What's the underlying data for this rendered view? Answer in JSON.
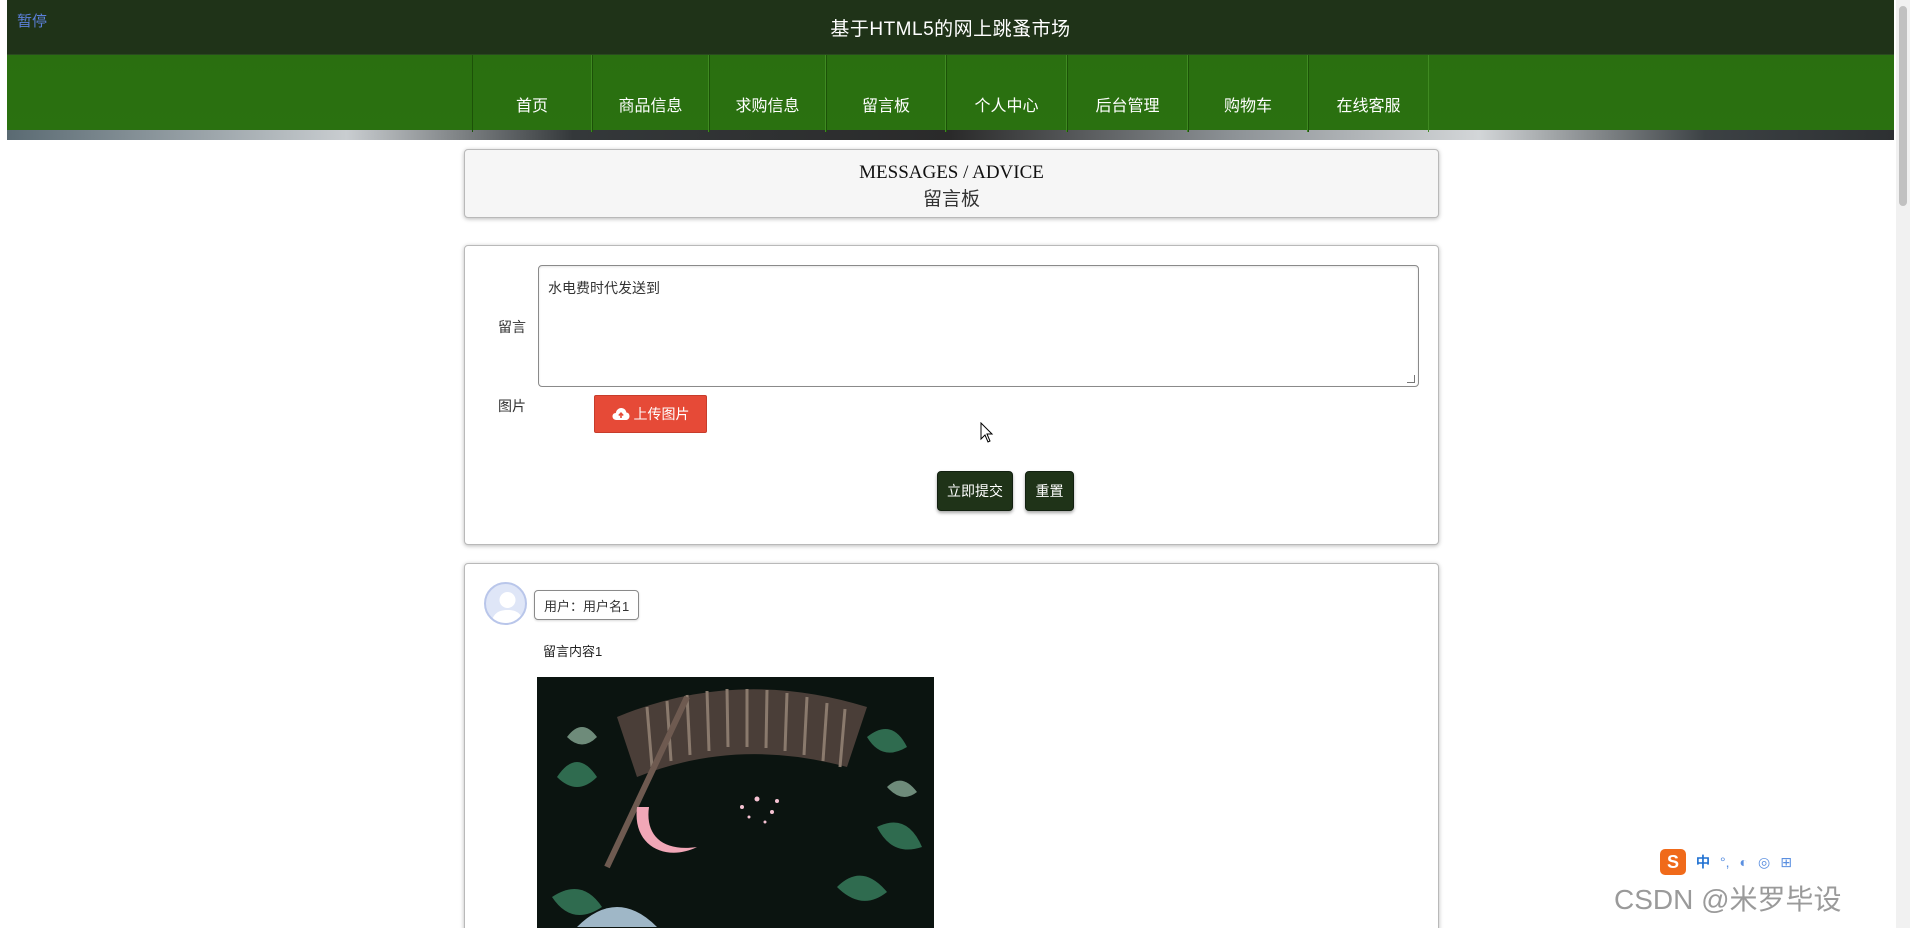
{
  "header": {
    "pause_label": "暂停",
    "site_title": "基于HTML5的网上跳蚤市场"
  },
  "nav": {
    "items": [
      "首页",
      "商品信息",
      "求购信息",
      "留言板",
      "个人中心",
      "后台管理",
      "购物车",
      "在线客服"
    ]
  },
  "section_header": {
    "title_en": "MESSAGES / ADVICE",
    "title_cn": "留言板"
  },
  "form": {
    "message_label": "留言",
    "message_value": "水电费时代发送到",
    "image_label": "图片",
    "upload_label": "上传图片",
    "submit_label": "立即提交",
    "reset_label": "重置"
  },
  "messages": [
    {
      "user_label": "用户：用户名1",
      "content": "留言内容1"
    }
  ],
  "overlay": {
    "ime_logo": "S",
    "ime_mode": "中",
    "watermark": "CSDN @米罗毕设"
  },
  "colors": {
    "topbar": "#1f3318",
    "nav_green": "#2a7110",
    "upload_red": "#e64a37",
    "button_dark": "#1f3318"
  }
}
